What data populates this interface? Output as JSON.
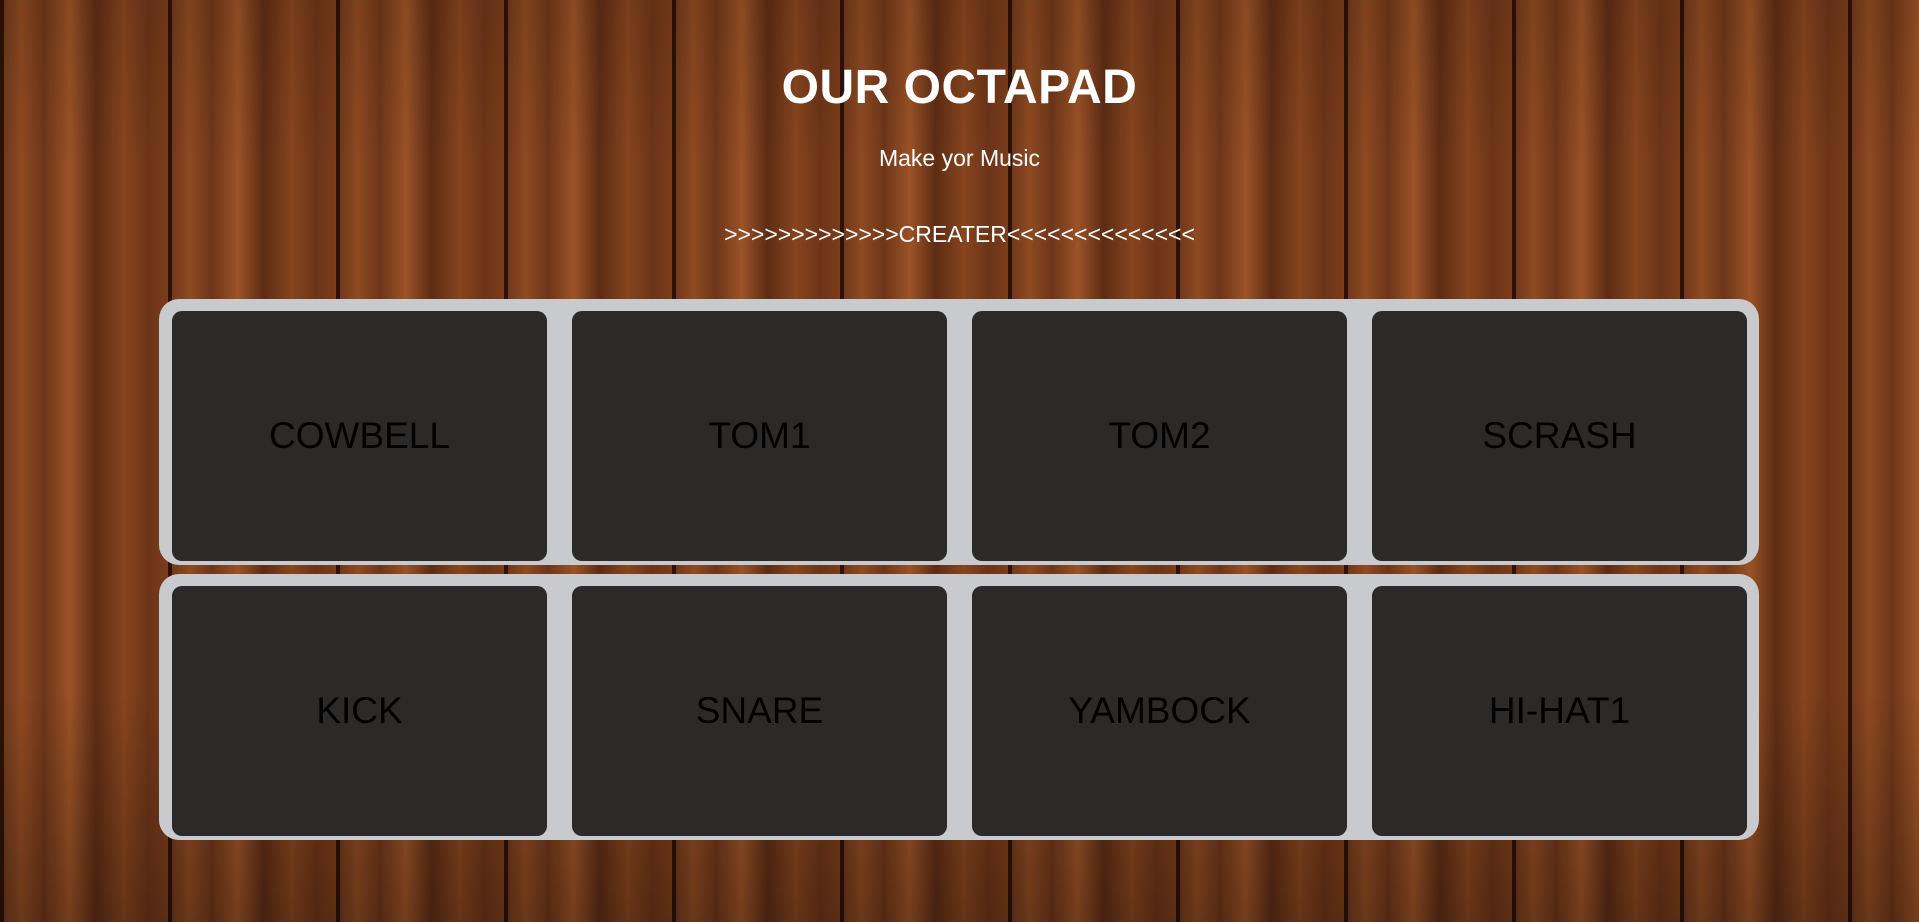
{
  "header": {
    "title": "OUR OCTAPAD",
    "subtitle": "Make yor Music",
    "creator": ">>>>>>>>>>>>>CREATER<<<<<<<<<<<<<<"
  },
  "pads": [
    {
      "label": "COWBELL"
    },
    {
      "label": "TOM1"
    },
    {
      "label": "TOM2"
    },
    {
      "label": "SCRASH"
    },
    {
      "label": "KICK"
    },
    {
      "label": "SNARE"
    },
    {
      "label": "YAMBOCK"
    },
    {
      "label": "HI-HAT1"
    }
  ],
  "colors": {
    "pad_background": "#2b2a29",
    "pad_frame": "#c8cacd",
    "pad_text": "#000000",
    "header_text": "#ffffff"
  }
}
